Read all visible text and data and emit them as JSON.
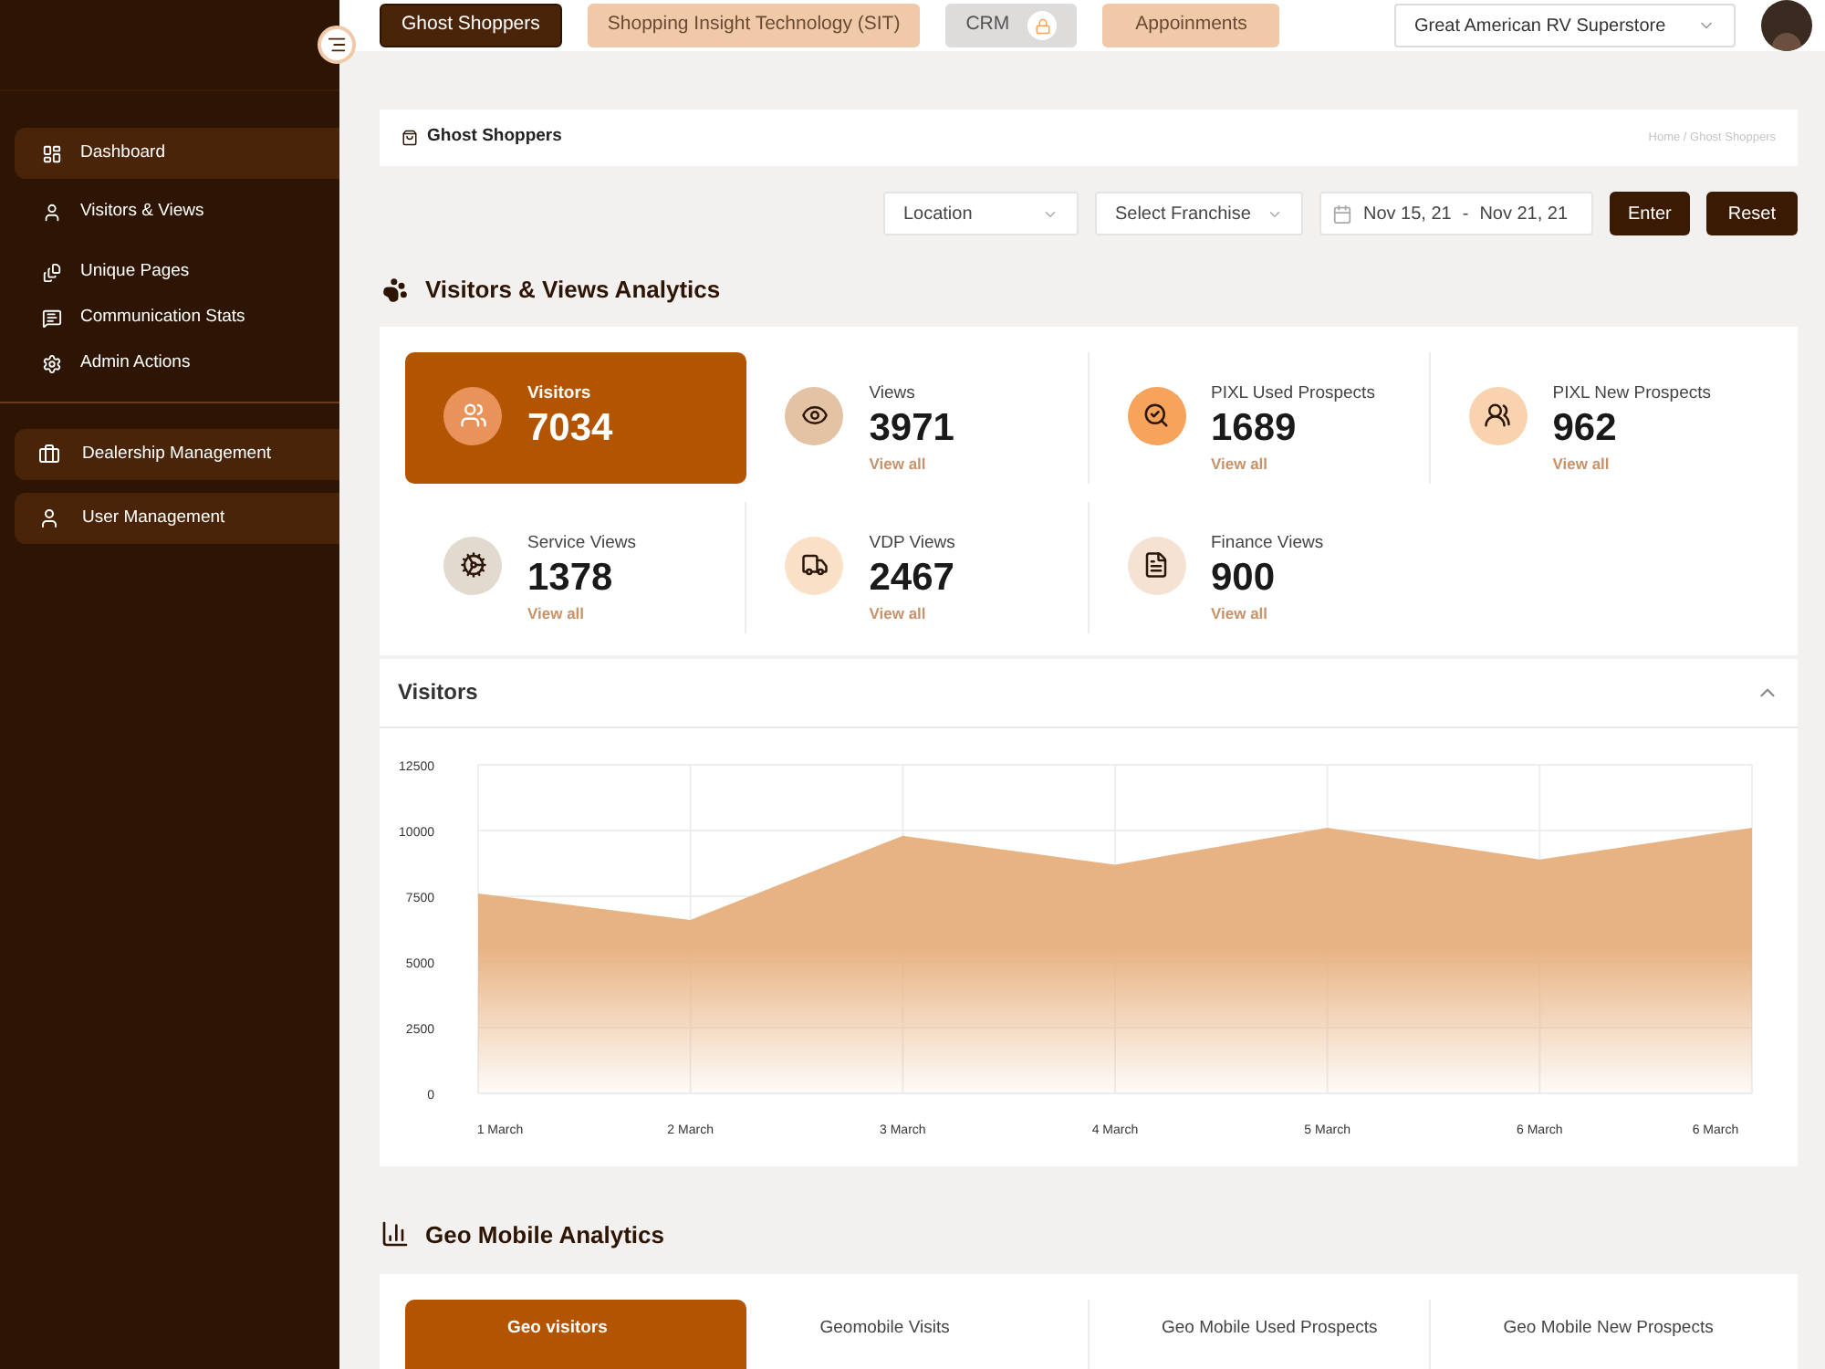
{
  "sidebar": {
    "items": [
      {
        "label": "Dashboard",
        "selected": true
      },
      {
        "label": "Visitors & Views",
        "selected": false
      },
      {
        "label": "Unique Pages",
        "selected": false
      },
      {
        "label": "Communication Stats",
        "selected": false
      },
      {
        "label": "Admin Actions",
        "selected": false
      }
    ],
    "sections": [
      {
        "label": "Dealership Management"
      },
      {
        "label": "User Management"
      }
    ]
  },
  "top_tabs": [
    {
      "label": "Ghost Shoppers",
      "selected": true,
      "locked": false
    },
    {
      "label": "Shopping Insight Technology (SIT)",
      "selected": false,
      "locked": false
    },
    {
      "label": "CRM",
      "selected": false,
      "locked": true
    },
    {
      "label": "Appoinments",
      "selected": false,
      "locked": false
    }
  ],
  "store_select": {
    "value": "Great American RV Superstore"
  },
  "page_title": "Ghost Shoppers",
  "breadcrumb": "Home / Ghost Shoppers",
  "filters": {
    "location": "Location",
    "franchise": "Select Franchise",
    "date_from": "Nov 15, 21",
    "date_sep": "-",
    "date_to": "Nov 21, 21",
    "enter": "Enter",
    "reset": "Reset"
  },
  "visitors_section": {
    "title": "Visitors & Views Analytics",
    "stats": [
      {
        "label": "Visitors",
        "value": "7034",
        "color": "#e8935a",
        "selected": true
      },
      {
        "label": "Views",
        "value": "3971",
        "link": "View all",
        "color": "#e3c3a4",
        "selected": false
      },
      {
        "label": "PIXL Used Prospects",
        "value": "1689",
        "link": "View all",
        "color": "#f7a35c",
        "selected": false
      },
      {
        "label": "PIXL New Prospects",
        "value": "962",
        "link": "View all",
        "color": "#f9d3b0",
        "selected": false
      },
      {
        "label": "Service Views",
        "value": "1378",
        "link": "View all",
        "color": "#e2d9cf",
        "selected": false
      },
      {
        "label": "VDP Views",
        "value": "2467",
        "link": "View all",
        "color": "#fbe0c8",
        "selected": false
      },
      {
        "label": "Finance Views",
        "value": "900",
        "link": "View all",
        "color": "#f5e2d3",
        "selected": false
      }
    ]
  },
  "visitors_chart": {
    "title": "Visitors",
    "expanded": true,
    "chart_data": {
      "type": "area",
      "categories": [
        "1 March",
        "2 March",
        "3 March",
        "4 March",
        "5 March",
        "6 March",
        "6 March"
      ],
      "values": [
        7600,
        6600,
        9800,
        8700,
        10100,
        8900,
        10100
      ],
      "ylim": [
        0,
        12500
      ],
      "grid": true,
      "yticks": [
        0,
        2500,
        5000,
        7500,
        10000,
        12500
      ]
    }
  },
  "geo_section": {
    "title": "Geo Mobile Analytics",
    "stats": [
      {
        "label": "Geo visitors",
        "selected": true
      },
      {
        "label": "Geomobile Visits",
        "selected": false
      },
      {
        "label": "Geo Mobile Used Prospects",
        "selected": false
      },
      {
        "label": "Geo Mobile New Prospects",
        "selected": false
      }
    ]
  }
}
